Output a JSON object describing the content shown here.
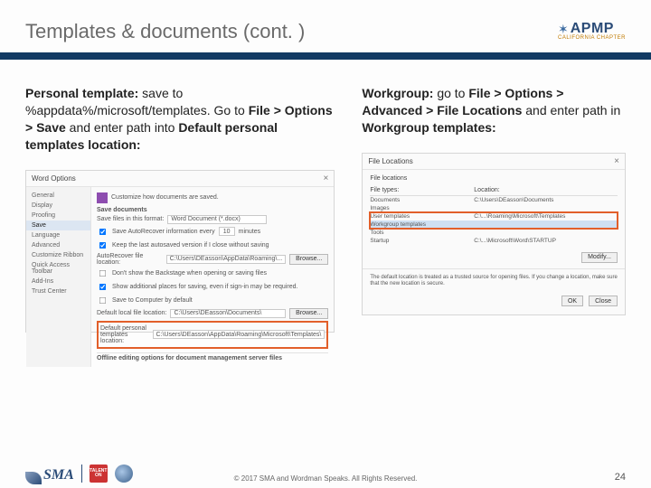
{
  "header": {
    "title": "Templates & documents (cont. )",
    "logo": {
      "brand": "APMP",
      "subtitle": "CALIFORNIA CHAPTER"
    }
  },
  "left": {
    "para_bold": "Personal template:",
    "para_rest1": " save to ",
    "para_path": "%appdata%/microsoft/templates",
    "para_rest2": ". Go to ",
    "para_nav": "File > Options > Save",
    "para_rest3": " and enter path into ",
    "para_nav2": "Default personal templates location:",
    "dlg_title": "Word Options",
    "nav": [
      "General",
      "Display",
      "Proofing",
      "Save",
      "Language",
      "Advanced",
      "Customize Ribbon",
      "Quick Access Toolbar",
      "Add-Ins",
      "Trust Center"
    ],
    "save_section": "Customize how documents are saved.",
    "save_docs": "Save documents",
    "fmt_label": "Save files in this format:",
    "fmt_value": "Word Document (*.docx)",
    "auto_label": "Save AutoRecover information every",
    "auto_value": "10",
    "auto_unit": "minutes",
    "keep_label": "Keep the last autosaved version if I close without saving",
    "arloc_label": "AutoRecover file location:",
    "arloc_value": "C:\\Users\\DEasson\\AppData\\Roaming\\...",
    "noshow_label": "Don't show the Backstage when opening or saving files",
    "addplaces_label": "Show additional places for saving, even if sign-in may be required.",
    "savecomp_label": "Save to Computer by default",
    "defloc_label": "Default local file location:",
    "defloc_value": "C:\\Users\\DEasson\\Documents\\",
    "defpers_label": "Default personal templates location:",
    "defpers_value": "C:\\Users\\DEasson\\AppData\\Roaming\\Microsoft\\Templates\\",
    "offline_label": "Offline editing options for document management server files",
    "browse_btn": "Browse..."
  },
  "right": {
    "para_bold": "Workgroup:",
    "para_rest1": " go to ",
    "para_nav": "File > Options > Advanced > File Locations",
    "para_rest2": " and enter path in ",
    "para_nav2": "Workgroup templates:",
    "dlg_title": "File Locations",
    "section": "File locations",
    "col1": "File types:",
    "col2": "Location:",
    "rows": [
      {
        "t": "Documents",
        "l": "C:\\Users\\DEasson\\Documents"
      },
      {
        "t": "Images",
        "l": ""
      },
      {
        "t": "User templates",
        "l": "C:\\...\\Roaming\\Microsoft\\Templates"
      },
      {
        "t": "Workgroup templates",
        "l": ""
      },
      {
        "t": "Tools",
        "l": ""
      },
      {
        "t": "Startup",
        "l": "C:\\...\\Microsoft\\Word\\STARTUP"
      }
    ],
    "modify_btn": "Modify...",
    "note": "The default location is treated as a trusted source for opening files. If you change a location, make sure that the new location is secure.",
    "ok_btn": "OK",
    "close_btn": "Close"
  },
  "footer": {
    "sma": "SMA",
    "talent1": "TALENT",
    "talent2": "ON",
    "copyright": "© 2017 SMA and Wordman Speaks. All Rights Reserved.",
    "page": "24"
  }
}
